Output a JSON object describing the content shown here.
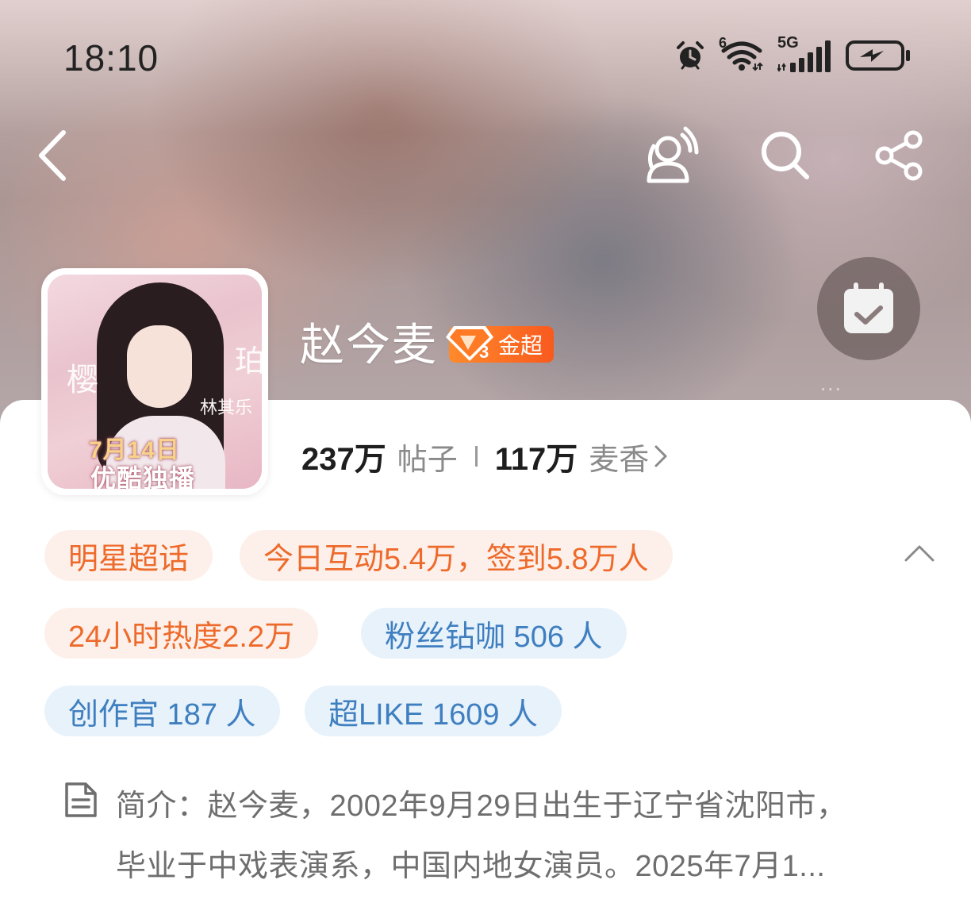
{
  "status_bar": {
    "time": "18:10",
    "icons": [
      "alarm-icon",
      "wifi-icon",
      "signal-5g-icon",
      "battery-charging-icon"
    ],
    "network_label": "5G",
    "wifi_gen": "6"
  },
  "nav": {
    "icons": [
      "back-icon",
      "people-voice-icon",
      "search-icon",
      "share-icon"
    ]
  },
  "avatar": {
    "poster_date": "7月14日",
    "poster_channel": "优酷独播",
    "poster_side_left": "樱",
    "poster_side_right": "珀",
    "poster_actor": "林其乐"
  },
  "topic": {
    "name": "赵今麦",
    "badge_level": "3",
    "badge_label": "金超",
    "faded_label": "..."
  },
  "stats": {
    "posts_count": "237万",
    "posts_label": "帖子",
    "fans_count": "117万",
    "fans_label": "麦香"
  },
  "tags": [
    {
      "text": "明星超话",
      "style": "orange"
    },
    {
      "text": "今日互动5.4万，签到5.8万人",
      "style": "orange"
    },
    {
      "text": "24小时热度2.2万",
      "style": "orange"
    },
    {
      "text": "粉丝钻咖 506 人",
      "style": "blue"
    },
    {
      "text": "创作官 187 人",
      "style": "blue"
    },
    {
      "text": "超LIKE 1609 人",
      "style": "blue"
    }
  ],
  "intro": {
    "line1": "简介：赵今麦，2002年9月29日出生于辽宁省沈阳市，",
    "line2": "毕业于中戏表演系，中国内地女演员。2025年7月1..."
  },
  "colors": {
    "accent_orange": "#ee6a2b",
    "accent_blue": "#3f7fc0",
    "badge_orange": "#f85a1e"
  }
}
